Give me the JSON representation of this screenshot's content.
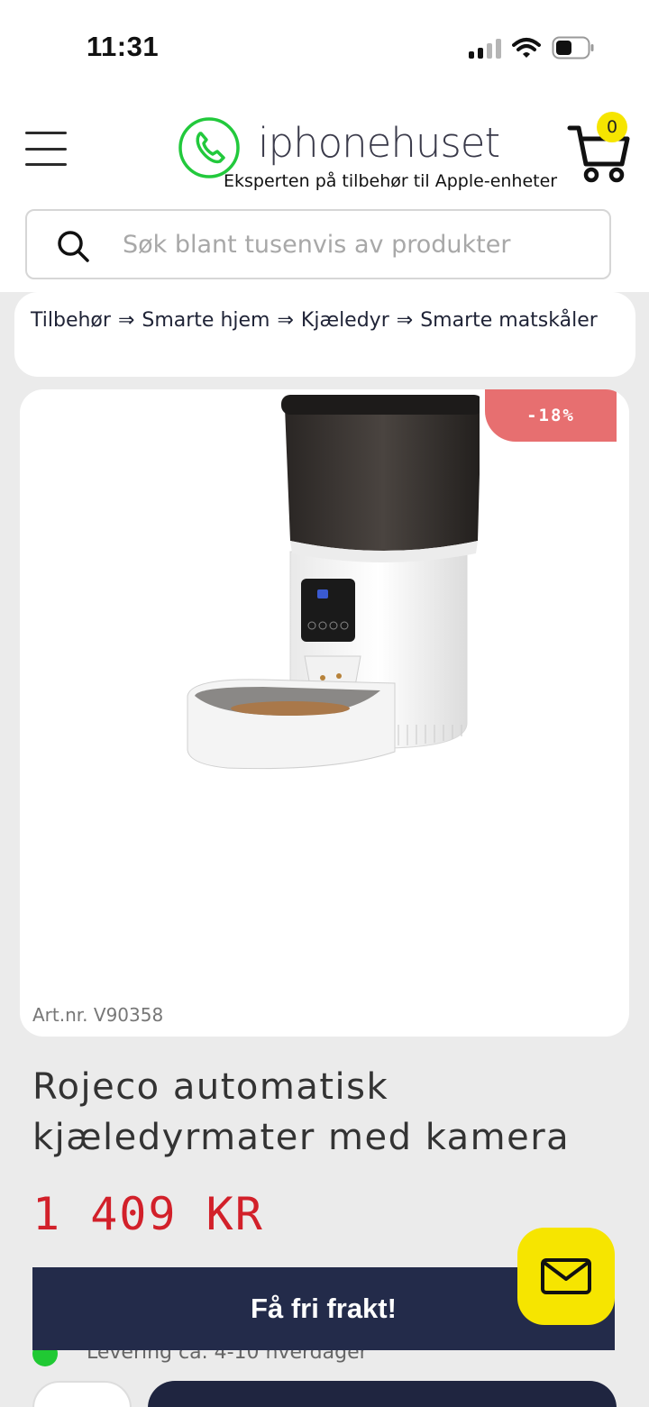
{
  "status_bar": {
    "time": "11:31"
  },
  "header": {
    "brand_name": "iphonehuset",
    "tagline": "Eksperten på tilbehør til Apple-enheter",
    "cart_count": "0",
    "brand_color": "#22c93c",
    "accent_yellow": "#f6e500"
  },
  "search": {
    "placeholder": "Søk blant tusenvis av produkter",
    "value": ""
  },
  "breadcrumb": {
    "separator": "⇒",
    "items": [
      "Tilbehør",
      "Smarte hjem",
      "Kjæledyr",
      "Smarte matskåler"
    ]
  },
  "product": {
    "discount_badge": "-18%",
    "art_nr": "Art.nr. V90358",
    "title": "Rojeco automatisk kjæledyrmater med kamera",
    "price": "1 409 KR",
    "delivery": "Levering ca. 4-10 hverdager"
  },
  "banner": {
    "label": "Få fri frakt!"
  },
  "icons": {
    "menu": "hamburger-menu-icon",
    "logo": "phone-handset-logo-icon",
    "cart": "shopping-cart-icon",
    "search": "search-icon",
    "mail": "mail-icon"
  },
  "colors": {
    "price": "#d2202a",
    "discount": "#e76f70",
    "navy": "#232b4a",
    "in_stock": "#20c933"
  }
}
